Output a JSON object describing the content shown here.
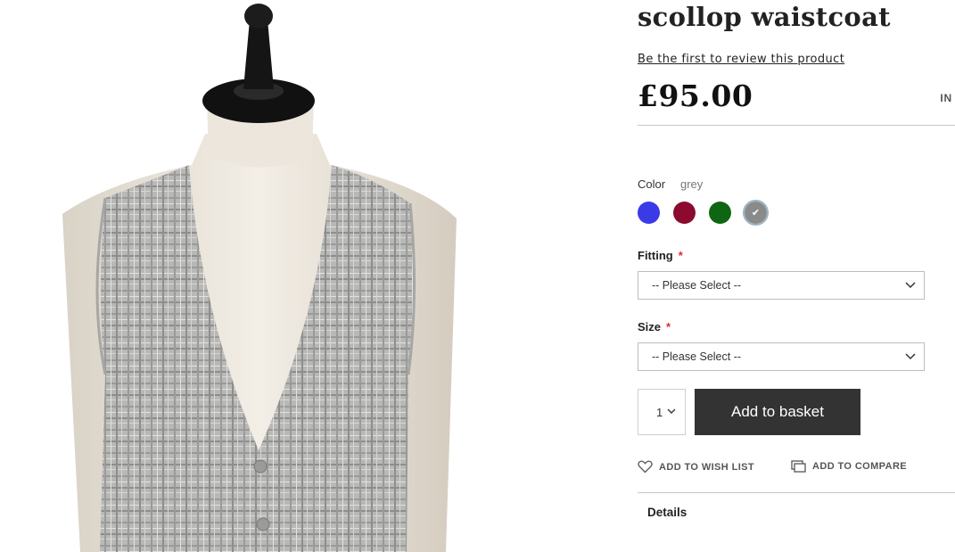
{
  "product": {
    "title": "scollop waistcoat",
    "review_link": "Be the first to review this product",
    "price": "£95.00",
    "stock_status": "IN",
    "image_alt": "grey check scollop waistcoat on mannequin"
  },
  "color": {
    "label": "Color",
    "selected_value": "grey",
    "swatches": [
      {
        "name": "blue",
        "hex": "#3a3ae6"
      },
      {
        "name": "burgundy",
        "hex": "#8c0a2e"
      },
      {
        "name": "green",
        "hex": "#0f6612"
      },
      {
        "name": "grey",
        "hex": "#8a8a8a",
        "selected": true
      }
    ]
  },
  "fitting": {
    "label": "Fitting",
    "required_mark": "*",
    "value": "-- Please Select --"
  },
  "size": {
    "label": "Size",
    "required_mark": "*",
    "value": "-- Please Select --"
  },
  "quantity": {
    "value": "1"
  },
  "add_to_basket": "Add to basket",
  "actions": {
    "wish_list": "ADD TO WISH LIST",
    "compare": "ADD TO COMPARE"
  },
  "tabs": {
    "details": "Details"
  },
  "colors": {
    "button_bg": "#333333",
    "required": "#e02b27",
    "divider": "#c8c8c8"
  }
}
